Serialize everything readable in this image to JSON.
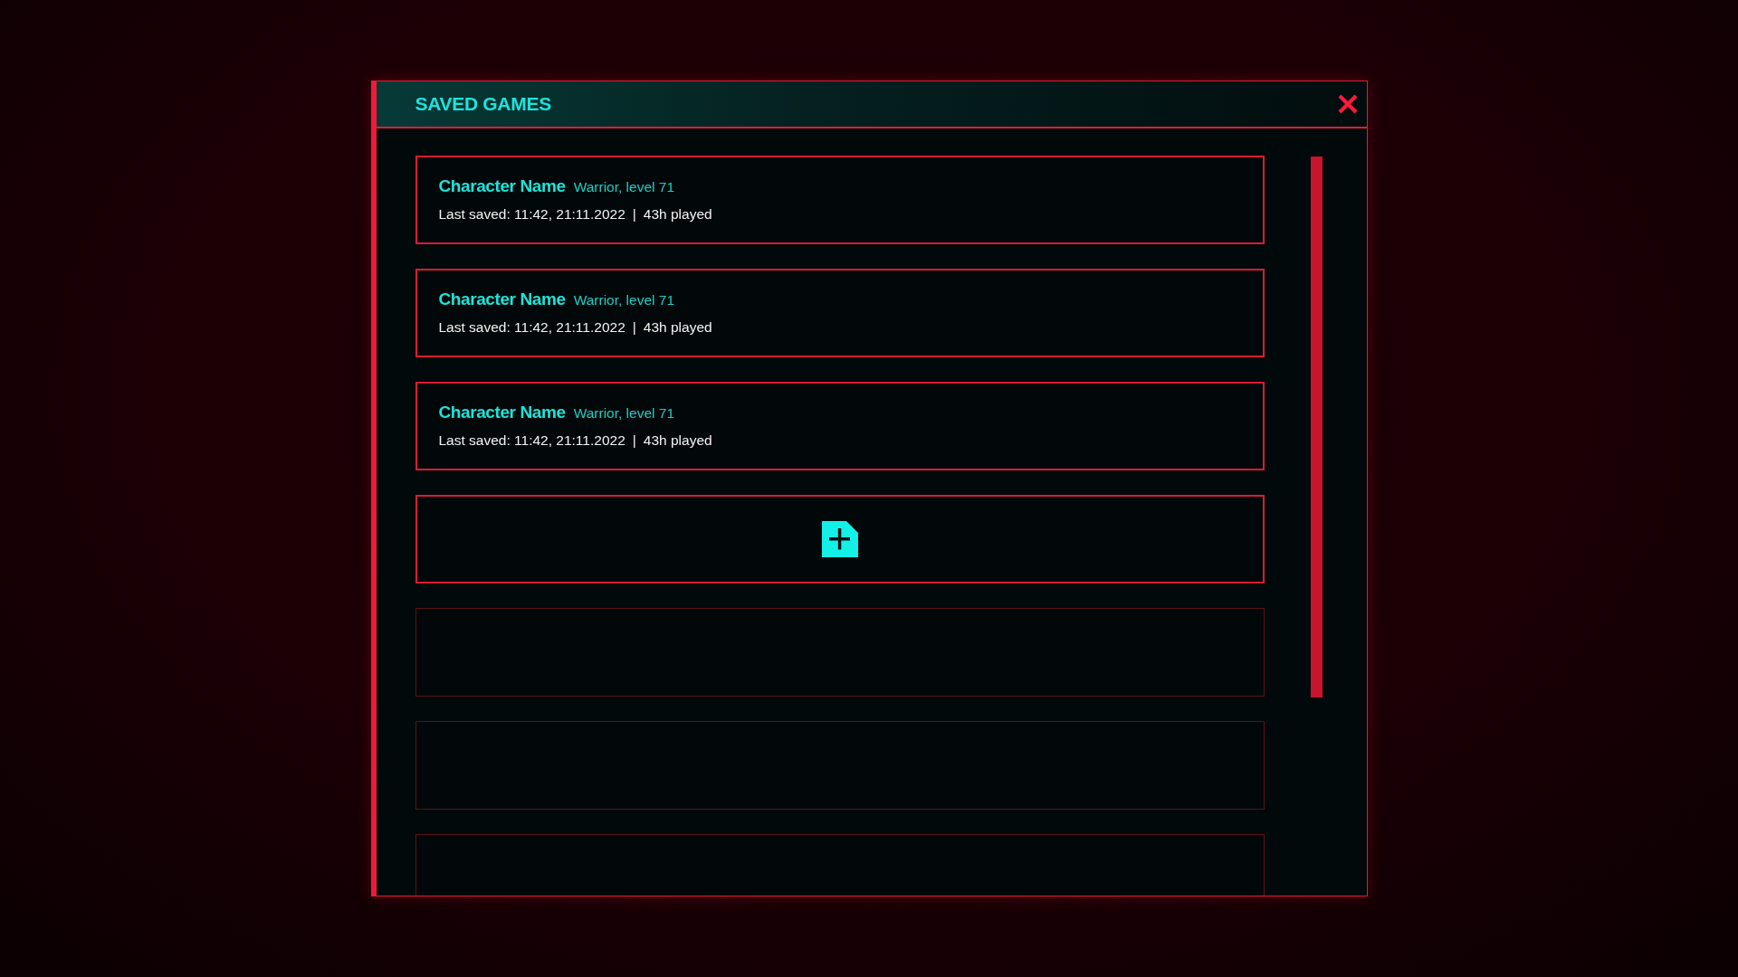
{
  "dialog": {
    "title": "SAVED GAMES"
  },
  "slots": [
    {
      "kind": "save",
      "character_name": "Character Name",
      "class_level": "Warrior, level 71",
      "last_saved": "Last saved: 11:42, 21:11.2022",
      "separator": "|",
      "playtime": "43h played"
    },
    {
      "kind": "save",
      "character_name": "Character Name",
      "class_level": "Warrior, level 71",
      "last_saved": "Last saved: 11:42, 21:11.2022",
      "separator": "|",
      "playtime": "43h played"
    },
    {
      "kind": "save",
      "character_name": "Character Name",
      "class_level": "Warrior, level 71",
      "last_saved": "Last saved: 11:42, 21:11.2022",
      "separator": "|",
      "playtime": "43h played"
    },
    {
      "kind": "new"
    },
    {
      "kind": "empty"
    },
    {
      "kind": "empty"
    },
    {
      "kind": "empty"
    }
  ]
}
